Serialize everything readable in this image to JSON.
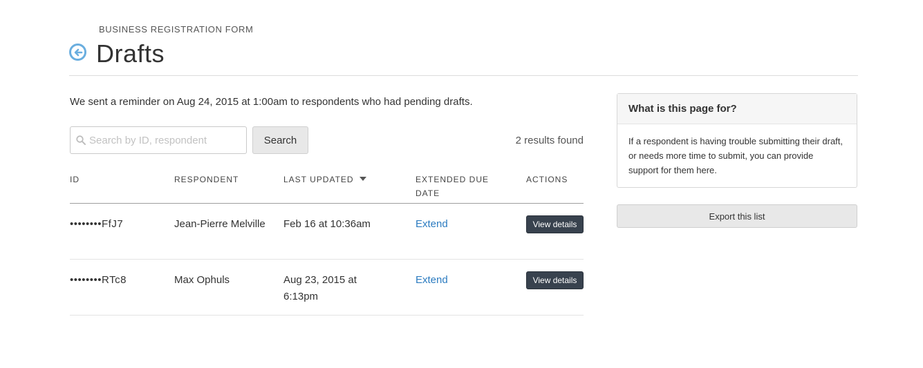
{
  "header": {
    "eyebrow": "BUSINESS REGISTRATION FORM",
    "title": "Drafts",
    "back_icon": "back-arrow-circle-icon",
    "accent_color": "#6aaedf"
  },
  "reminder": "We sent a reminder on Aug 24, 2015 at 1:00am to respondents who had pending drafts.",
  "search": {
    "placeholder": "Search by ID, respondent",
    "value": "",
    "button_label": "Search",
    "icon": "search-icon"
  },
  "results_text": "2 results found",
  "table": {
    "columns": [
      "ID",
      "RESPONDENT",
      "LAST UPDATED",
      "EXTENDED DUE DATE",
      "ACTIONS"
    ],
    "sort_indicator": "caret-down-icon",
    "rows": [
      {
        "id": "••••••••FfJ7",
        "respondent": "Jean-Pierre Melville",
        "last_updated": "Feb 16 at 10:36am",
        "extend_label": "Extend",
        "action_label": "View details"
      },
      {
        "id": "••••••••RTc8",
        "respondent": "Max Ophuls",
        "last_updated": "Aug 23, 2015 at 6:13pm",
        "extend_label": "Extend",
        "action_label": "View details"
      }
    ]
  },
  "help": {
    "heading": "What is this page for?",
    "body": "If a respondent is having trouble submitting their draft, or needs more time to submit, you can provide support for them here."
  },
  "export_label": "Export this list",
  "colors": {
    "link": "#2b7bc0",
    "dark_button": "#38424e"
  }
}
